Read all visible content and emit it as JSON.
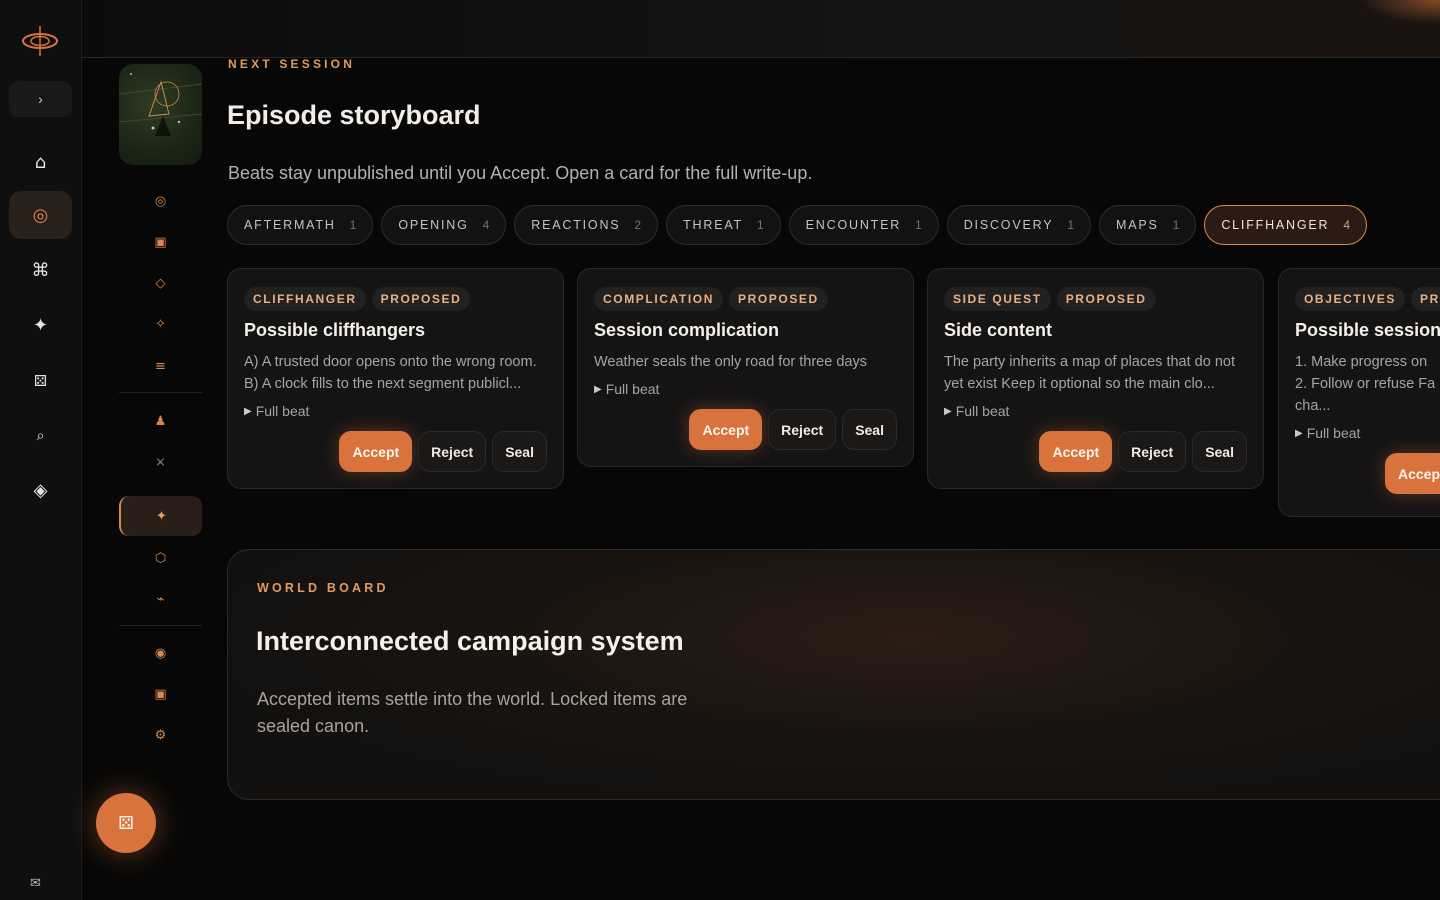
{
  "header": {
    "eyebrow": "NEXT SESSION",
    "title": "Episode storyboard",
    "subtitle": "Beats stay unpublished until you Accept. Open a card for the full write-up."
  },
  "tabs": [
    {
      "label": "AFTERMATH",
      "count": "1"
    },
    {
      "label": "OPENING",
      "count": "4"
    },
    {
      "label": "REACTIONS",
      "count": "2"
    },
    {
      "label": "THREAT",
      "count": "1"
    },
    {
      "label": "ENCOUNTER",
      "count": "1"
    },
    {
      "label": "DISCOVERY",
      "count": "1"
    },
    {
      "label": "MAPS",
      "count": "1"
    },
    {
      "label": "CLIFFHANGER",
      "count": "4"
    }
  ],
  "cards": [
    {
      "tag": "CLIFFHANGER",
      "status": "PROPOSED",
      "title": "Possible cliffhangers",
      "body": "A) A trusted door opens onto the wrong room. B) A clock fills to the next segment publicl...",
      "more": "Full beat"
    },
    {
      "tag": "COMPLICATION",
      "status": "PROPOSED",
      "title": "Session complication",
      "body": "Weather seals the only road for three days",
      "more": "Full beat"
    },
    {
      "tag": "SIDE QUEST",
      "status": "PROPOSED",
      "title": "Side content",
      "body": "The party inherits a map of places that do not yet exist Keep it optional so the main clo...",
      "more": "Full beat"
    },
    {
      "tag": "OBJECTIVES",
      "status": "PR",
      "title": "Possible session",
      "body_line1": "1. Make progress on ",
      "body_line2": "2. Follow or refuse Fa",
      "body_line3": "cha...",
      "more": "Full beat"
    }
  ],
  "actions": {
    "accept": "Accept",
    "reject": "Reject",
    "seal": "Seal",
    "accept_partial": "Accep"
  },
  "world": {
    "eyebrow": "WORLD BOARD",
    "title": "Interconnected campaign system",
    "text": "Accepted items settle into the world. Locked items are sealed canon."
  },
  "icons": {
    "rail": [
      "chevron-right",
      "home",
      "target",
      "command",
      "sparkle",
      "dice",
      "search",
      "diamond",
      "mail"
    ],
    "accent": "#d9733e"
  }
}
